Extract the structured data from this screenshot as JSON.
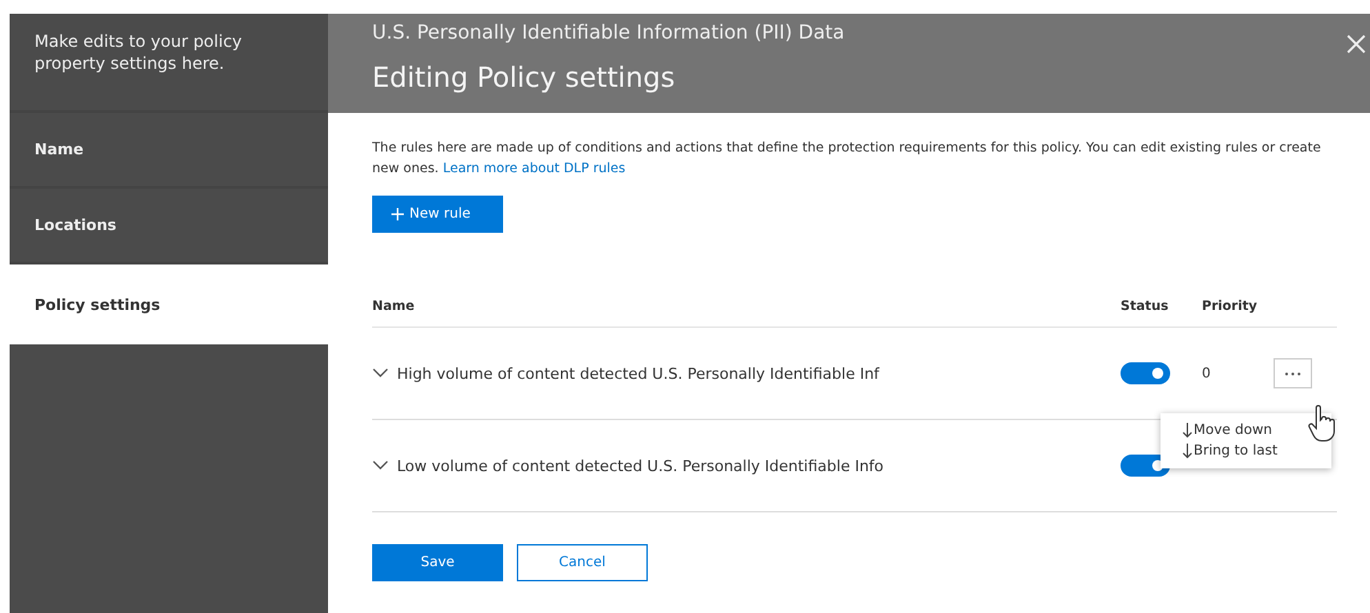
{
  "sidebar": {
    "description": "Make edits to your policy property settings here.",
    "items": [
      {
        "label": "Name",
        "selected": false
      },
      {
        "label": "Locations",
        "selected": false
      },
      {
        "label": "Policy settings",
        "selected": true
      }
    ]
  },
  "header": {
    "policy_name": "U.S. Personally Identifiable Information (PII) Data",
    "title": "Editing Policy settings"
  },
  "intro": {
    "text": "The rules here are made up of conditions and actions that define the protection requirements for this policy. You can edit existing rules or create new ones.",
    "link": "Learn more about DLP rules"
  },
  "new_rule_button": "New rule",
  "table": {
    "columns": [
      "Name",
      "Status",
      "Priority"
    ],
    "rows": [
      {
        "name": "High volume of content detected U.S. Personally Identifiable Inf",
        "on": true,
        "priority": "0"
      },
      {
        "name": "Low volume of content detected U.S. Personally Identifiable Info",
        "on": true
      }
    ]
  },
  "context_menu": {
    "items": [
      "Move down",
      "Bring to last"
    ]
  },
  "buttons": {
    "save": "Save",
    "cancel": "Cancel"
  }
}
